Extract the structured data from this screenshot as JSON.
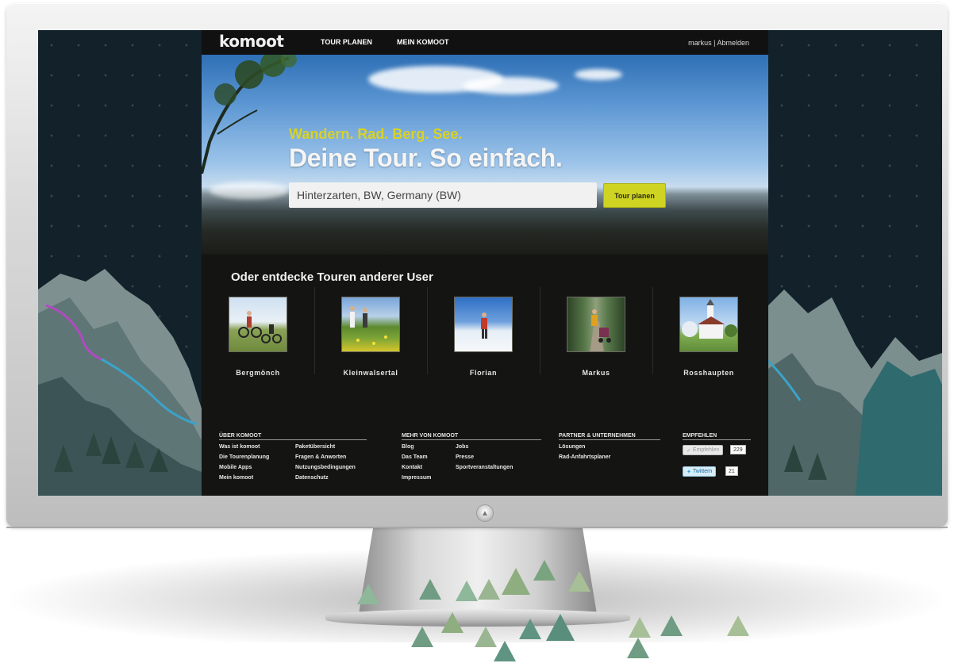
{
  "nav": {
    "logo": "komoot",
    "items": [
      "TOUR PLANEN",
      "MEIN KOMOOT"
    ],
    "user": "markus",
    "separator": "|",
    "logout": "Abmelden"
  },
  "hero": {
    "tagline": "Wandern. Rad. Berg. See.",
    "title": "Deine Tour. So einfach.",
    "search_value": "Hinterzarten, BW, Germany (BW)",
    "button": "Tour planen"
  },
  "discover": {
    "title": "Oder entdecke Touren anderer User",
    "tours": [
      {
        "label": "Bergmönch",
        "icon": "bike-photo"
      },
      {
        "label": "Kleinwalsertal",
        "icon": "meadow-photo"
      },
      {
        "label": "Florian",
        "icon": "snow-photo"
      },
      {
        "label": "Markus",
        "icon": "forest-path-photo"
      },
      {
        "label": "Rosshaupten",
        "icon": "chapel-photo"
      }
    ]
  },
  "footer": {
    "col1": {
      "title": "ÜBER KOMOOT",
      "links_a": [
        "Was ist komoot",
        "Die Tourenplanung",
        "Mobile Apps",
        "Mein komoot"
      ],
      "links_b": [
        "Paketübersicht",
        "Fragen & Anworten",
        "Nutzungsbedingungen",
        "Datenschutz"
      ]
    },
    "col2": {
      "title": "MEHR VON KOMOOT",
      "links_a": [
        "Blog",
        "Das Team",
        "Kontakt",
        "Impressum"
      ],
      "links_b": [
        "Jobs",
        "Presse",
        "Sportveranstaltungen"
      ]
    },
    "col3": {
      "title": "PARTNER & UNTERNEHMEN",
      "links": [
        "Lösungen",
        "Rad-Anfahrtsplaner"
      ]
    },
    "col4": {
      "title": "EMPFEHLEN",
      "recommend_label": "Empfehlen",
      "recommend_count": "229",
      "twitter_label": "Twittern",
      "twitter_count": "21"
    }
  },
  "colors": {
    "accent": "#cfd322",
    "tagline": "#d9d224",
    "page_bg": "#141412"
  }
}
